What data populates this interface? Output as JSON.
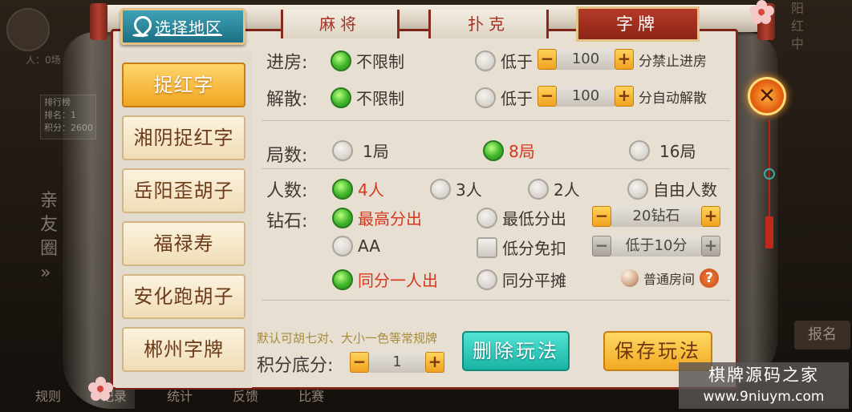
{
  "background": {
    "top_small_texts": [
      "人：0场",
      "排行榜",
      "排名：1",
      "积分：2600"
    ],
    "side_vertical": "亲友圈 »",
    "bottom_nav": [
      "规则",
      "记录",
      "统计",
      "反馈",
      "比赛"
    ],
    "right_vertical": "阳红中",
    "signup": "报名"
  },
  "region": {
    "label": "选择地区",
    "icon": "map-pin-icon"
  },
  "tabs": [
    {
      "label": "麻将",
      "active": false
    },
    {
      "label": "扑克",
      "active": false
    },
    {
      "label": "字牌",
      "active": true
    }
  ],
  "games": [
    {
      "label": "捉红字",
      "active": true
    },
    {
      "label": "湘阴捉红字",
      "active": false
    },
    {
      "label": "岳阳歪胡子",
      "active": false
    },
    {
      "label": "福禄寿",
      "active": false
    },
    {
      "label": "安化跑胡子",
      "active": false
    },
    {
      "label": "郴州字牌",
      "active": false
    }
  ],
  "settings": {
    "entry": {
      "label": "进房:",
      "option_unlimited": "不限制",
      "option_below": "低于",
      "value": "100",
      "suffix": "分禁止进房",
      "selected": "unlimited"
    },
    "dissolve": {
      "label": "解散:",
      "option_unlimited": "不限制",
      "option_below": "低于",
      "value": "100",
      "suffix": "分自动解散",
      "selected": "unlimited"
    },
    "rounds": {
      "label": "局数:",
      "options": [
        "1局",
        "8局",
        "16局"
      ],
      "selected": "8局"
    },
    "players": {
      "label": "人数:",
      "options": [
        "4人",
        "3人",
        "2人",
        "自由人数"
      ],
      "selected": "4人"
    },
    "diamonds": {
      "label": "钻石:",
      "option_highest": "最高分出",
      "option_lowest": "最低分出",
      "option_aa": "AA",
      "option_low_exempt": "低分免扣",
      "option_same_one": "同分一人出",
      "option_same_split": "同分平摊",
      "diamond_value": "20钻石",
      "low_value": "低于10分",
      "room_type": "普通房间",
      "help": "?",
      "selected": [
        "最高分出",
        "同分一人出"
      ]
    }
  },
  "bottom": {
    "note": "默认可胡七对、大小一色等常规牌",
    "score_label": "积分底分:",
    "score_value": "1",
    "delete_label": "删除玩法",
    "save_label": "保存玩法"
  },
  "close": {
    "symbol": "✕"
  },
  "watermark": {
    "line1": "棋牌源码之家",
    "line2": "www.9niuym.com"
  },
  "colors": {
    "accent_red": "#8a2a1c",
    "selected_text": "#d6381f",
    "radio_on": "#3fb52a",
    "teal_button": "#19b3a4",
    "gold_button": "#f2a923"
  }
}
